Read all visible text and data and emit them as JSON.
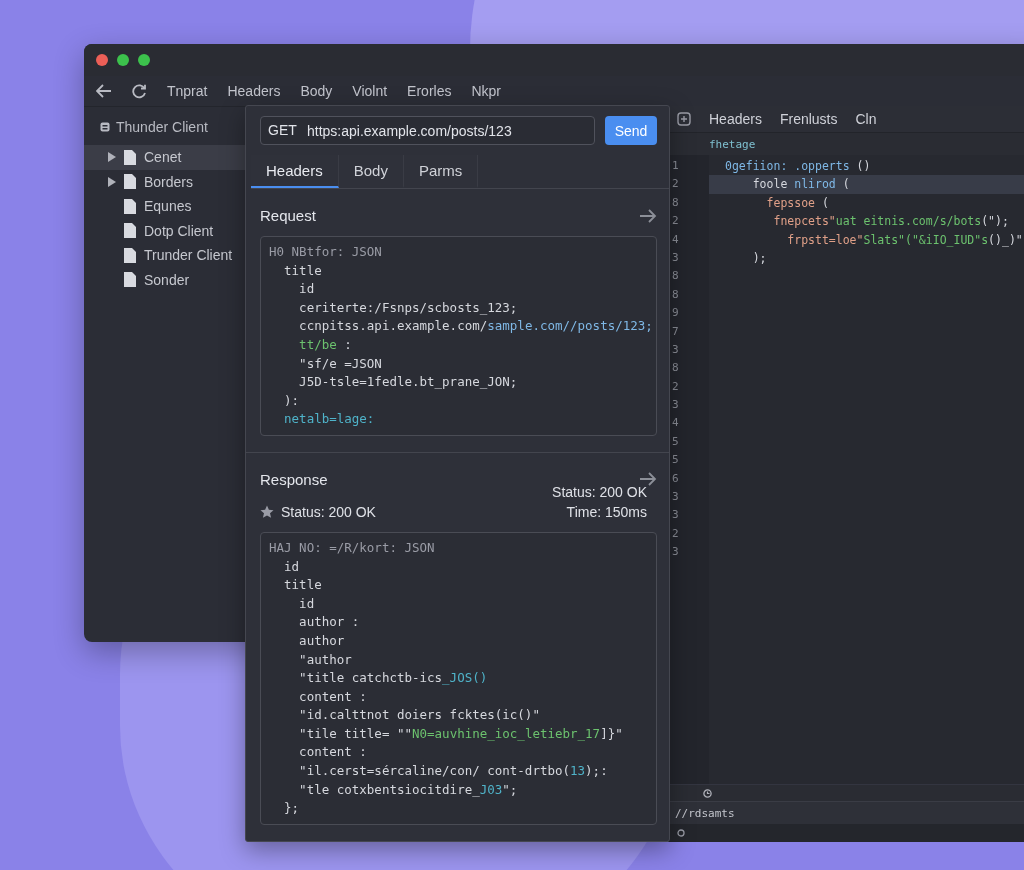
{
  "window": {
    "toolbar": [
      "Tnprat",
      "Headers",
      "Body",
      "Violnt",
      "Erorles",
      "Nkpr"
    ]
  },
  "sidebar": {
    "title": "Thunder Client",
    "items": [
      {
        "label": "Cenet",
        "kind": "collapsible",
        "selected": true
      },
      {
        "label": "Borders",
        "kind": "collapsible",
        "selected": false
      },
      {
        "label": "Equnes",
        "kind": "leaf",
        "selected": false
      },
      {
        "label": "Dotp Client",
        "kind": "leaf",
        "selected": false
      },
      {
        "label": "Trunder Client",
        "kind": "leaf",
        "selected": false
      },
      {
        "label": "Sonder",
        "kind": "leaf",
        "selected": false
      }
    ]
  },
  "request_panel": {
    "method": "GET",
    "url": "https:api.example.com/posts/123",
    "send": "Send",
    "tabs": [
      {
        "label": "Headers",
        "selected": true
      },
      {
        "label": "Body",
        "selected": false
      },
      {
        "label": "Parms",
        "selected": false
      }
    ],
    "request": {
      "title": "Request",
      "code": [
        [
          {
            "text": "H0 NBtfor: JSON",
            "kind": "comment"
          }
        ],
        [
          {
            "text": "  title",
            "kind": "plain"
          }
        ],
        [
          {
            "text": "    id",
            "kind": "plain"
          }
        ],
        [
          {
            "text": "    ceriterte:/Fsnps/scbosts_123;",
            "kind": "plain"
          }
        ],
        [
          {
            "text": "    ccnpitss.api.example.com/",
            "kind": "plain"
          },
          {
            "text": "sample.com//posts/123;",
            "kind": "link"
          }
        ],
        [
          {
            "text": "    tt/be",
            "kind": "green"
          },
          {
            "text": " :",
            "kind": "plain"
          }
        ],
        [
          {
            "text": "    \"sf/e =JSON",
            "kind": "plain"
          }
        ],
        [
          {
            "text": "    J5D-tsle=1fedle.bt_prane_JON;",
            "kind": "plain"
          }
        ],
        [
          {
            "text": "  ):",
            "kind": "plain"
          }
        ],
        [
          {
            "text": "  netalb=lage:",
            "kind": "teal"
          }
        ]
      ]
    },
    "response": {
      "title": "Response",
      "status_right": "Status: 200 OK",
      "time": "Time: 150ms",
      "status_left": "Status: 200 OK",
      "code": [
        [
          {
            "text": "HAJ NO: =/R/kort: JSON",
            "kind": "comment"
          }
        ],
        [
          {
            "text": "  id",
            "kind": "plain"
          }
        ],
        [
          {
            "text": "  title",
            "kind": "plain"
          }
        ],
        [
          {
            "text": "    id",
            "kind": "plain"
          }
        ],
        [
          {
            "text": "    author :",
            "kind": "plain"
          }
        ],
        [
          {
            "text": "    author",
            "kind": "plain"
          }
        ],
        [
          {
            "text": "    \"author",
            "kind": "plain"
          }
        ],
        [
          {
            "text": "    \"title catchctb-ics",
            "kind": "plain"
          },
          {
            "text": "_JOS()",
            "kind": "teal"
          }
        ],
        [
          {
            "text": "    content :",
            "kind": "plain"
          }
        ],
        [
          {
            "text": "    \"id.calttnot doiers fcktes(ic()\"",
            "kind": "plain"
          }
        ],
        [
          {
            "text": "    \"tile title= \"\"",
            "kind": "plain"
          },
          {
            "text": "N0=auvhine_ioc_letiebr_17",
            "kind": "green"
          },
          {
            "text": "]}\"",
            "kind": "plain"
          }
        ],
        [
          {
            "text": "    content :",
            "kind": "plain"
          }
        ],
        [
          {
            "text": "    \"il.cerst=sércaline/con/ cont-drtbo(",
            "kind": "plain"
          },
          {
            "text": "13",
            "kind": "teal"
          },
          {
            "text": ");:",
            "kind": "plain"
          }
        ],
        [
          {
            "text": "    \"tle cotxbentsiocitdire_",
            "kind": "plain"
          },
          {
            "text": "J03",
            "kind": "teal"
          },
          {
            "text": "\";",
            "kind": "plain"
          }
        ],
        [
          {
            "text": "  };",
            "kind": "plain"
          }
        ]
      ]
    }
  },
  "editor": {
    "tabs": [
      "Headers",
      "Frenlusts",
      "Cln"
    ],
    "breadcrumb": "fhetage",
    "line_numbers": [
      "1",
      "2",
      "8",
      "2",
      "4",
      "3",
      "8",
      "8",
      "9",
      "7",
      "3",
      "8",
      "2",
      "3",
      "4",
      "5",
      "5",
      "6",
      "3",
      "3",
      "2",
      "3"
    ],
    "lines": [
      {
        "highlighted": false,
        "tokens": [
          {
            "text": "0gefiion: .opperts",
            "kind": "link"
          },
          {
            "text": " ()",
            "kind": "plain"
          }
        ]
      },
      {
        "highlighted": true,
        "tokens": [
          {
            "text": "    foole ",
            "kind": "plain"
          },
          {
            "text": "nlirod",
            "kind": "link"
          },
          {
            "text": " (",
            "kind": "plain"
          }
        ]
      },
      {
        "highlighted": false,
        "tokens": [
          {
            "text": "      fepssoe",
            "kind": "orange"
          },
          {
            "text": " (",
            "kind": "plain"
          }
        ]
      },
      {
        "highlighted": false,
        "tokens": [
          {
            "text": "       fnepcets\"",
            "kind": "orange"
          },
          {
            "text": "uat eitnis.com/s/bots",
            "kind": "green"
          },
          {
            "text": "(\");",
            "kind": "plain"
          }
        ]
      },
      {
        "highlighted": false,
        "tokens": [
          {
            "text": "         frpstt=loe\"",
            "kind": "orange"
          },
          {
            "text": "Slats\"(\"&iIO_IUD\"s",
            "kind": "green"
          },
          {
            "text": "()_)\"",
            "kind": "plain"
          }
        ]
      },
      {
        "highlighted": false,
        "tokens": [
          {
            "text": "    );",
            "kind": "plain"
          }
        ]
      }
    ],
    "status": "//rdsamts"
  }
}
